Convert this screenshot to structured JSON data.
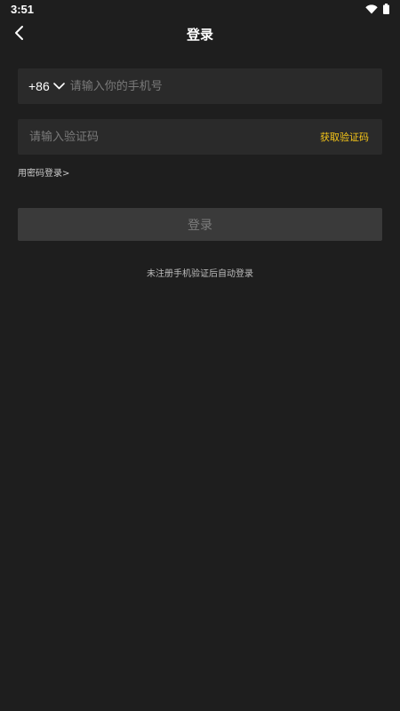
{
  "status_bar": {
    "time": "3:51",
    "icons": [
      "wifi-icon",
      "battery-icon"
    ]
  },
  "header": {
    "title": "登录",
    "back_icon": "chevron-left-icon"
  },
  "phone_field": {
    "country_code": "+86",
    "placeholder": "请输入你的手机号",
    "value": ""
  },
  "code_field": {
    "placeholder": "请输入验证码",
    "value": "",
    "get_code_label": "获取验证码"
  },
  "password_login_link": "用密码登录>",
  "login_button": "登录",
  "hint": "未注册手机验证后自动登录",
  "colors": {
    "background": "#1e1e1e",
    "field_background": "#2a2a2a",
    "accent": "#f5c518",
    "button_background": "#3a3a3a"
  }
}
